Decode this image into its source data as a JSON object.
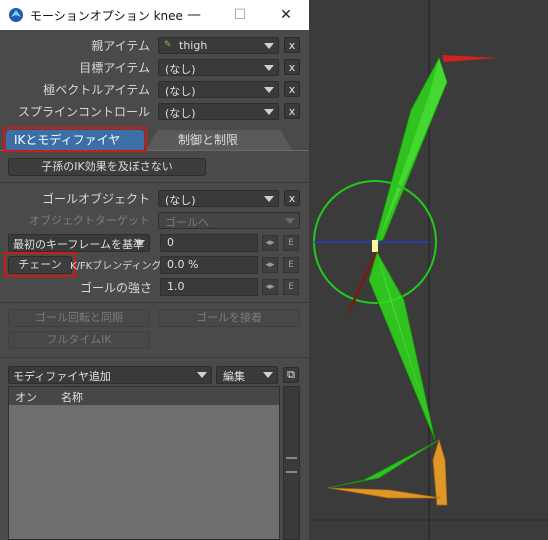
{
  "window": {
    "title": "モーションオプション knee",
    "minimize": "—",
    "maximize": "☐",
    "close": "✕"
  },
  "parent_item": {
    "label": "親アイテム",
    "value": "thigh"
  },
  "target_item": {
    "label": "目標アイテム",
    "value": "(なし)"
  },
  "pole_vector": {
    "label": "極ベクトルアイテム",
    "value": "(なし)"
  },
  "spline_control": {
    "label": "スプラインコントロール",
    "value": "(なし)"
  },
  "clear_label": "x",
  "tabs": [
    {
      "label": "IKとモディファイヤ",
      "active": true
    },
    {
      "label": "制御と制限",
      "active": false
    }
  ],
  "ik_block_button": "子孫のIK効果を及ぼさない",
  "goal_object": {
    "label": "ゴールオブジェクト",
    "value": "(なし)"
  },
  "object_target": {
    "label": "オブジェクトターゲット",
    "value": "ゴールへ"
  },
  "first_keyframe": {
    "label": "最初のキーフレームを基準",
    "value": "0"
  },
  "chain": {
    "button": "チェーン",
    "label": "K/FKブレンディング",
    "value": "0.0 %"
  },
  "goal_strength": {
    "label": "ゴールの強さ",
    "value": "1.0"
  },
  "envelope_btn": "E",
  "sync_goal_rotation": "ゴール回転と同期",
  "goal_attach": "ゴールを接着",
  "full_time_ik": "フルタイムIK",
  "add_modifier": "モディファイヤ追加",
  "edit": "編集",
  "list_columns": [
    "オン",
    "名称"
  ],
  "colors": {
    "highlight": "#d01a1a",
    "active_tab": "#3c6fa8",
    "bone_green": "#2fdc1c",
    "bone_orange": "#f2a326"
  }
}
